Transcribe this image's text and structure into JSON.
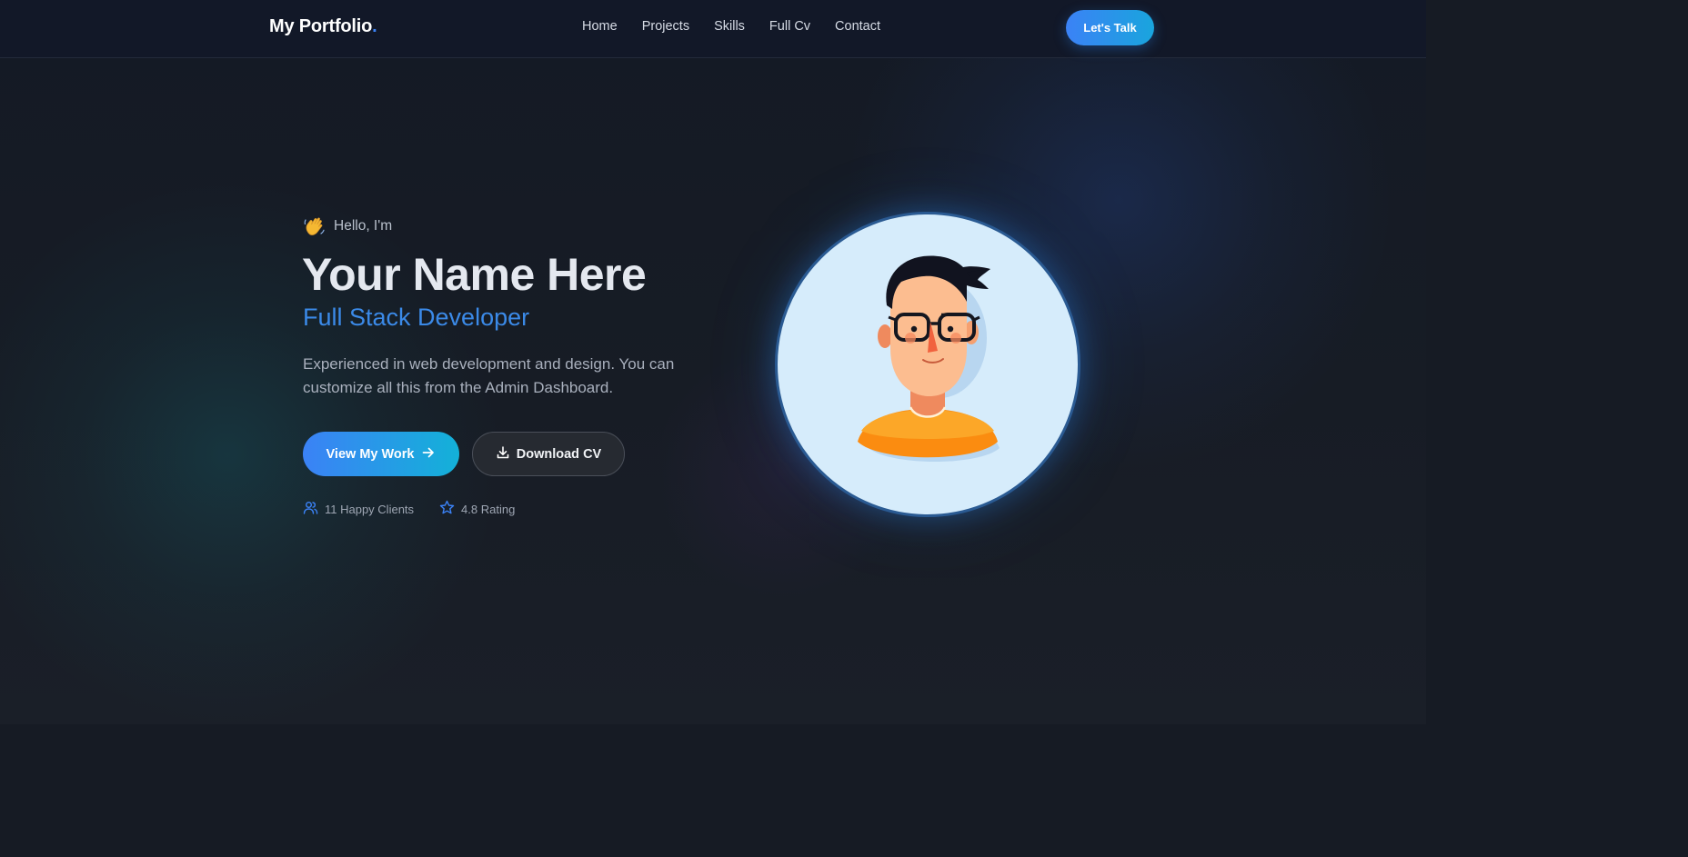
{
  "navbar": {
    "brand": "My Portfolio",
    "brand_dot": ".",
    "links": [
      {
        "label": "Home"
      },
      {
        "label": "Projects"
      },
      {
        "label": "Skills"
      },
      {
        "label": "Full Cv"
      },
      {
        "label": "Contact"
      }
    ],
    "cta_label": "Let's Talk"
  },
  "hero": {
    "greeting": "Hello, I'm",
    "greeting_icon": "waving-hand-icon",
    "name": "Your Name Here",
    "role": "Full Stack Developer",
    "description": "Experienced in web development and design. You can customize all this from the Admin Dashboard.",
    "primary_button": {
      "label": "View My Work",
      "icon": "arrow-right-icon"
    },
    "secondary_button": {
      "label": "Download CV",
      "icon": "download-icon"
    },
    "stats": [
      {
        "icon": "users-icon",
        "label": "11 Happy Clients"
      },
      {
        "icon": "star-icon",
        "label": "4.8 Rating"
      }
    ]
  },
  "colors": {
    "accent": "#3b82f6",
    "accent_secondary": "#13b1d8",
    "background": "#161b24",
    "navbar": "#121828"
  }
}
